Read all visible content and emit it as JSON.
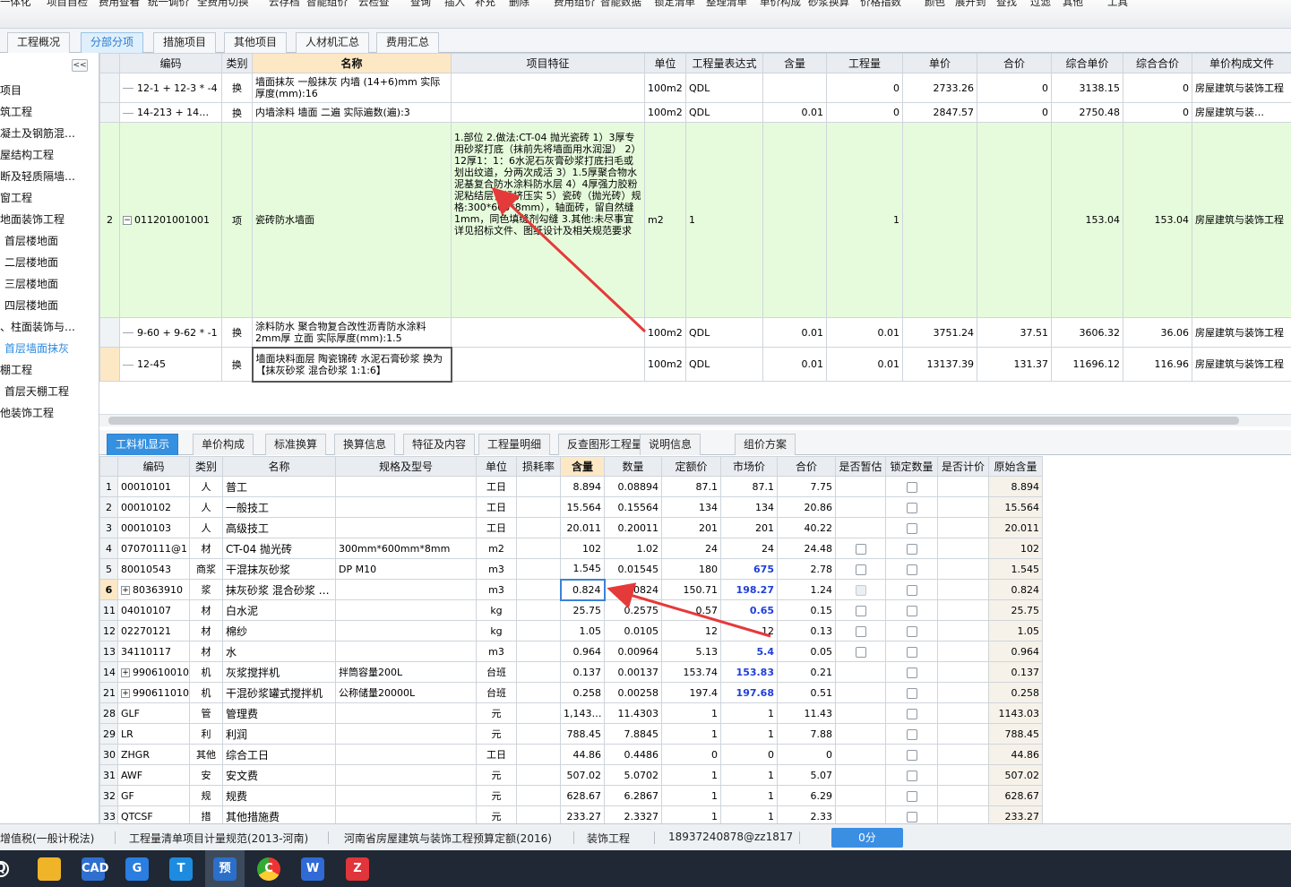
{
  "toolbar": {
    "items": [
      "一体化",
      "项目自检",
      "费用查看",
      "统一调价",
      "全费用切换",
      "云存档",
      "智能组价",
      "云检查",
      "查询",
      "插入",
      "补充",
      "删除",
      "费用组价",
      "智能数据",
      "锁定清单",
      "整理清单",
      "单价构成",
      "砂浆换算",
      "价格指数",
      "颜色",
      "展开到",
      "查找",
      "过滤",
      "其他",
      "工具"
    ]
  },
  "top_tabs": [
    "工程概况",
    "分部分项",
    "措施项目",
    "其他项目",
    "人材机汇总",
    "费用汇总"
  ],
  "sidebar": {
    "collapse_label": "<<",
    "items": [
      "项目",
      "筑工程",
      "凝土及钢筋混…",
      "屋结构工程",
      "断及轻质隔墙…",
      "窗工程",
      "地面装饰工程",
      "首层楼地面",
      "二层楼地面",
      "三层楼地面",
      "四层楼地面",
      "、柱面装饰与…",
      "首层墙面抹灰",
      "棚工程",
      "首层天棚工程",
      "他装饰工程"
    ]
  },
  "upper_grid": {
    "headers": [
      "编码",
      "类别",
      "名称",
      "项目特征",
      "单位",
      "工程量表达式",
      "含量",
      "工程量",
      "单价",
      "合价",
      "综合单价",
      "综合合价",
      "单价构成文件"
    ],
    "rows": [
      {
        "num": "",
        "code": "12-1 + 12-3 * -4",
        "type": "换",
        "name": "墙面抹灰 一般抹灰 内墙 (14+6)mm 实际厚度(mm):16",
        "feature": "",
        "unit": "100m2",
        "expr": "QDL",
        "content": "",
        "qty": "0",
        "price": "2733.26",
        "total": "0",
        "comp_price": "3138.15",
        "comp_total": "0",
        "file": "房屋建筑与装饰工程",
        "extra": "装"
      },
      {
        "num": "",
        "code": "14-213 + 14…",
        "type": "换",
        "name": "内墙涂料 墙面 二遍 实际遍数(遍):3",
        "feature": "",
        "unit": "100m2",
        "expr": "QDL",
        "content": "0.01",
        "qty": "0",
        "price": "2847.57",
        "total": "0",
        "comp_price": "2750.48",
        "comp_total": "0",
        "file": "房屋建筑与装…",
        "extra": "装"
      },
      {
        "num": "2",
        "code": "011201001001",
        "type": "项",
        "name": "瓷砖防水墙面",
        "feature": "1.部位\n2.做法:CT-04 抛光瓷砖\n1）3厚专用砂浆打底（抹前先将墙面用水润湿）\n2）12厚1：1：6水泥石灰膏砂浆打底扫毛或划出纹道，分两次成活\n3）1.5厚聚合物水泥基复合防水涂料防水层\n4）4厚强力胶粉泥粘结层，揉挤压实\n5）瓷砖（抛光砖）规格:300*600*8mm），轴面砖，留自然缝1mm，同色填缝剂勾缝\n3.其他:未尽事宜详见招标文件、图纸设计及相关规范要求",
        "unit": "m2",
        "expr": "1",
        "content": "",
        "qty": "1",
        "price": "",
        "total": "",
        "comp_price": "153.04",
        "comp_total": "153.04",
        "file": "房屋建筑与装饰工程",
        "extra": "装"
      },
      {
        "num": "",
        "code": "9-60 + 9-62 * -1",
        "type": "换",
        "name": "涂料防水 聚合物复合改性沥青防水涂料 2mm厚 立面 实际厚度(mm):1.5",
        "feature": "",
        "unit": "100m2",
        "expr": "QDL",
        "content": "0.01",
        "qty": "0.01",
        "price": "3751.24",
        "total": "37.51",
        "comp_price": "3606.32",
        "comp_total": "36.06",
        "file": "房屋建筑与装饰工程",
        "extra": "建"
      },
      {
        "num": "",
        "code": "12-45",
        "type": "换",
        "name": "墙面块料面层 陶瓷锦砖 水泥石膏砂浆 换为【抹灰砂浆 混合砂浆 1:1:6】",
        "feature": "",
        "unit": "100m2",
        "expr": "QDL",
        "content": "0.01",
        "qty": "0.01",
        "price": "13137.39",
        "total": "131.37",
        "comp_price": "11696.12",
        "comp_total": "116.96",
        "file": "房屋建筑与装饰工程",
        "extra": "装"
      }
    ]
  },
  "bottom_tabs": [
    "工料机显示",
    "单价构成",
    "标准换算",
    "换算信息",
    "特征及内容",
    "工程量明细",
    "反查图形工程量",
    "说明信息",
    "组价方案"
  ],
  "lower_grid": {
    "headers": [
      "",
      "编码",
      "类别",
      "名称",
      "规格及型号",
      "单位",
      "损耗率",
      "含量",
      "数量",
      "定额价",
      "市场价",
      "合价",
      "是否暂估",
      "锁定数量",
      "是否计价",
      "原始含量"
    ],
    "rows": [
      {
        "num": "1",
        "code": "00010101",
        "type": "人",
        "name": "普工",
        "spec": "",
        "unit": "工日",
        "loss": "",
        "content": "8.894",
        "qty": "0.08894",
        "base": "87.1",
        "market": "87.1",
        "total": "7.75",
        "est": "",
        "lock": "cb",
        "price": "",
        "orig": "8.894",
        "expand": false,
        "blue": false
      },
      {
        "num": "2",
        "code": "00010102",
        "type": "人",
        "name": "一般技工",
        "spec": "",
        "unit": "工日",
        "loss": "",
        "content": "15.564",
        "qty": "0.15564",
        "base": "134",
        "market": "134",
        "total": "20.86",
        "est": "",
        "lock": "cb",
        "price": "",
        "orig": "15.564",
        "expand": false,
        "blue": false
      },
      {
        "num": "3",
        "code": "00010103",
        "type": "人",
        "name": "高级技工",
        "spec": "",
        "unit": "工日",
        "loss": "",
        "content": "20.011",
        "qty": "0.20011",
        "base": "201",
        "market": "201",
        "total": "40.22",
        "est": "",
        "lock": "cb",
        "price": "",
        "orig": "20.011",
        "expand": false,
        "blue": false
      },
      {
        "num": "4",
        "code": "07070111@1",
        "type": "材",
        "name": "CT-04 抛光砖",
        "spec": "300mm*600mm*8mm",
        "unit": "m2",
        "loss": "",
        "content": "102",
        "qty": "1.02",
        "base": "24",
        "market": "24",
        "total": "24.48",
        "est": "cb",
        "lock": "cb",
        "price": "",
        "orig": "102",
        "expand": false,
        "blue": false
      },
      {
        "num": "5",
        "code": "80010543",
        "type": "商浆",
        "name": "干混抹灰砂浆",
        "spec": "DP M10",
        "unit": "m3",
        "loss": "",
        "content": "1.545",
        "qty": "0.01545",
        "base": "180",
        "market": "675",
        "total": "2.78",
        "est": "cb",
        "lock": "cb",
        "price": "",
        "orig": "1.545",
        "expand": false,
        "blue": true
      },
      {
        "num": "6",
        "code": "80363910",
        "type": "浆",
        "name": "抹灰砂浆 混合砂浆 …",
        "spec": "",
        "unit": "m3",
        "loss": "",
        "content": "0.824",
        "qty": "0.00824",
        "base": "150.71",
        "market": "198.27",
        "total": "1.24",
        "est": "dis",
        "lock": "cb",
        "price": "",
        "orig": "0.824",
        "expand": true,
        "blue": true
      },
      {
        "num": "11",
        "code": "04010107",
        "type": "材",
        "name": "白水泥",
        "spec": "",
        "unit": "kg",
        "loss": "",
        "content": "25.75",
        "qty": "0.2575",
        "base": "0.57",
        "market": "0.65",
        "total": "0.15",
        "est": "cb",
        "lock": "cb",
        "price": "",
        "orig": "25.75",
        "expand": false,
        "blue": true
      },
      {
        "num": "12",
        "code": "02270121",
        "type": "材",
        "name": "棉纱",
        "spec": "",
        "unit": "kg",
        "loss": "",
        "content": "1.05",
        "qty": "0.0105",
        "base": "12",
        "market": "12",
        "total": "0.13",
        "est": "cb",
        "lock": "cb",
        "price": "",
        "orig": "1.05",
        "expand": false,
        "blue": false
      },
      {
        "num": "13",
        "code": "34110117",
        "type": "材",
        "name": "水",
        "spec": "",
        "unit": "m3",
        "loss": "",
        "content": "0.964",
        "qty": "0.00964",
        "base": "5.13",
        "market": "5.4",
        "total": "0.05",
        "est": "cb",
        "lock": "cb",
        "price": "",
        "orig": "0.964",
        "expand": false,
        "blue": true
      },
      {
        "num": "14",
        "code": "990610010",
        "type": "机",
        "name": "灰浆搅拌机",
        "spec": "拌筒容量200L",
        "unit": "台班",
        "loss": "",
        "content": "0.137",
        "qty": "0.00137",
        "base": "153.74",
        "market": "153.83",
        "total": "0.21",
        "est": "",
        "lock": "cb",
        "price": "",
        "orig": "0.137",
        "expand": true,
        "blue": true
      },
      {
        "num": "21",
        "code": "990611010",
        "type": "机",
        "name": "干混砂浆罐式搅拌机",
        "spec": "公称储量20000L",
        "unit": "台班",
        "loss": "",
        "content": "0.258",
        "qty": "0.00258",
        "base": "197.4",
        "market": "197.68",
        "total": "0.51",
        "est": "",
        "lock": "cb",
        "price": "",
        "orig": "0.258",
        "expand": true,
        "blue": true
      },
      {
        "num": "28",
        "code": "GLF",
        "type": "管",
        "name": "管理费",
        "spec": "",
        "unit": "元",
        "loss": "",
        "content": "1,143…",
        "qty": "11.4303",
        "base": "1",
        "market": "1",
        "total": "11.43",
        "est": "",
        "lock": "cb",
        "price": "",
        "orig": "1143.03",
        "expand": false,
        "blue": false
      },
      {
        "num": "29",
        "code": "LR",
        "type": "利",
        "name": "利润",
        "spec": "",
        "unit": "元",
        "loss": "",
        "content": "788.45",
        "qty": "7.8845",
        "base": "1",
        "market": "1",
        "total": "7.88",
        "est": "",
        "lock": "cb",
        "price": "",
        "orig": "788.45",
        "expand": false,
        "blue": false
      },
      {
        "num": "30",
        "code": "ZHGR",
        "type": "其他",
        "name": "综合工日",
        "spec": "",
        "unit": "工日",
        "loss": "",
        "content": "44.86",
        "qty": "0.4486",
        "base": "0",
        "market": "0",
        "total": "0",
        "est": "",
        "lock": "cb",
        "price": "",
        "orig": "44.86",
        "expand": false,
        "blue": false
      },
      {
        "num": "31",
        "code": "AWF",
        "type": "安",
        "name": "安文费",
        "spec": "",
        "unit": "元",
        "loss": "",
        "content": "507.02",
        "qty": "5.0702",
        "base": "1",
        "market": "1",
        "total": "5.07",
        "est": "",
        "lock": "cb",
        "price": "",
        "orig": "507.02",
        "expand": false,
        "blue": false
      },
      {
        "num": "32",
        "code": "GF",
        "type": "规",
        "name": "规费",
        "spec": "",
        "unit": "元",
        "loss": "",
        "content": "628.67",
        "qty": "6.2867",
        "base": "1",
        "market": "1",
        "total": "6.29",
        "est": "",
        "lock": "cb",
        "price": "",
        "orig": "628.67",
        "expand": false,
        "blue": false
      },
      {
        "num": "33",
        "code": "QTCSF",
        "type": "措",
        "name": "其他措施费",
        "spec": "",
        "unit": "元",
        "loss": "",
        "content": "233.27",
        "qty": "2.3327",
        "base": "1",
        "market": "1",
        "total": "2.33",
        "est": "",
        "lock": "cb",
        "price": "",
        "orig": "233.27",
        "expand": false,
        "blue": false
      }
    ]
  },
  "status_bar": {
    "items": [
      "增值税(一般计税法)",
      "工程量清单项目计量规范(2013-河南)",
      "河南省房屋建筑与装饰工程预算定额(2016)",
      "装饰工程",
      "18937240878@zz1817"
    ],
    "button": "0分"
  },
  "taskbar": {
    "icons": [
      {
        "name": "search",
        "glyph": "Q",
        "color": "transparent"
      },
      {
        "name": "file-explorer",
        "glyph": "",
        "color": "#f0b429"
      },
      {
        "name": "cad",
        "glyph": "CAD",
        "color": "#2f6fd0"
      },
      {
        "name": "browser-swirl",
        "glyph": "G",
        "color": "#2a7de1"
      },
      {
        "name": "tencent-docs",
        "glyph": "T",
        "color": "#1d8ce0"
      },
      {
        "name": "budget-app",
        "glyph": "预",
        "color": "#2a6fc9"
      },
      {
        "name": "chrome",
        "glyph": "C",
        "color": "#e0a020"
      },
      {
        "name": "wps-writer",
        "glyph": "W",
        "color": "#2f6ad6"
      },
      {
        "name": "wps-z",
        "glyph": "Z",
        "color": "#e0353a"
      }
    ]
  },
  "colors": {
    "accent": "#3590e0",
    "green_row": "#e6fbdc",
    "arrow": "#e53a3a"
  }
}
